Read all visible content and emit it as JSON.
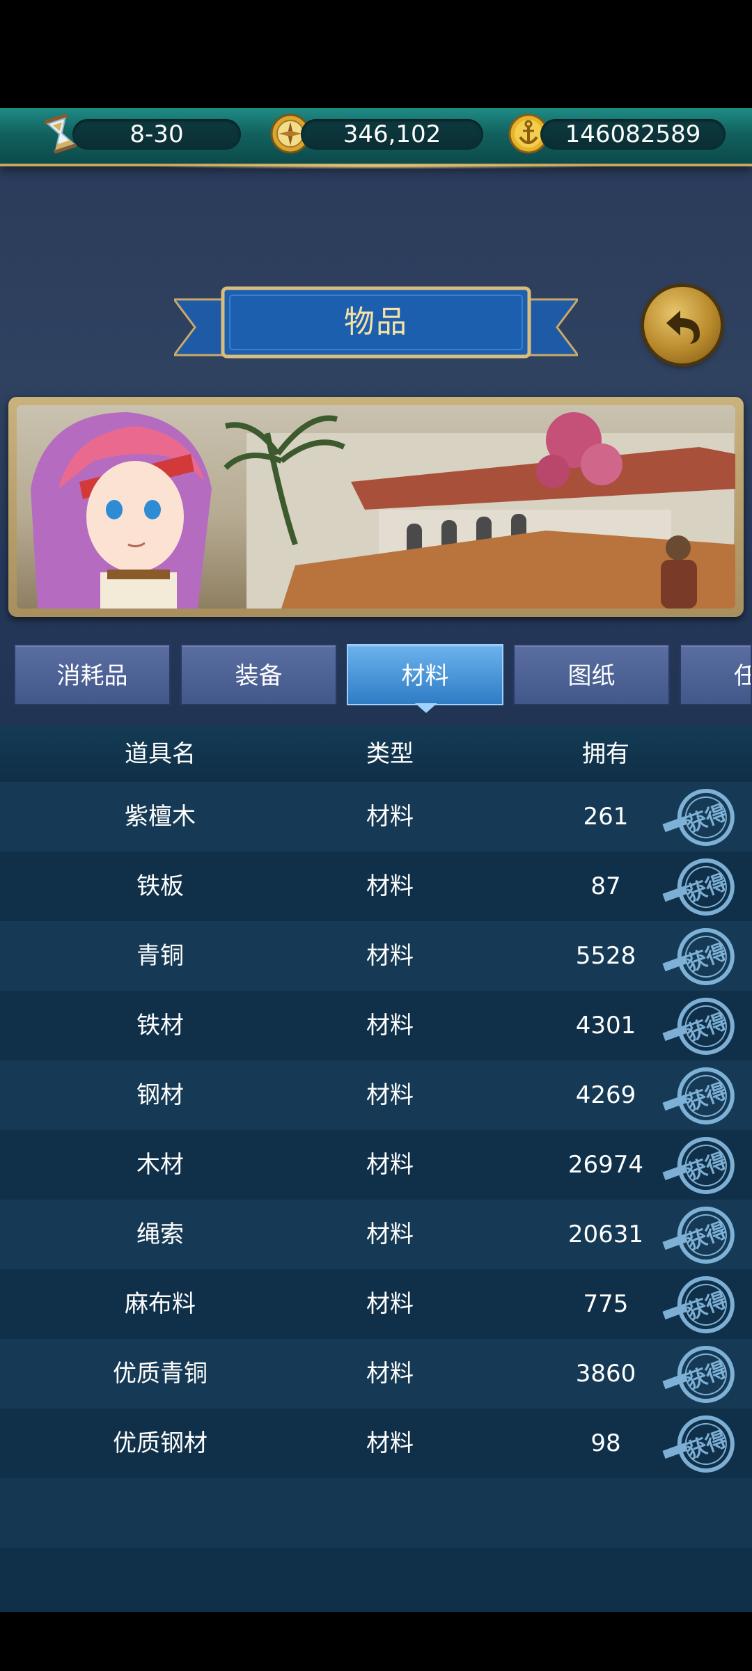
{
  "resources": {
    "time": "8-30",
    "compass_value": "346,102",
    "gold_value": "146082589"
  },
  "title": "物品",
  "tabs": [
    "消耗品",
    "装备",
    "材料",
    "图纸",
    "任"
  ],
  "active_tab": 2,
  "table": {
    "headers": [
      "道具名",
      "类型",
      "拥有"
    ],
    "rows": [
      {
        "name": "紫檀木",
        "type": "材料",
        "count": "261"
      },
      {
        "name": "铁板",
        "type": "材料",
        "count": "87"
      },
      {
        "name": "青铜",
        "type": "材料",
        "count": "5528"
      },
      {
        "name": "铁材",
        "type": "材料",
        "count": "4301"
      },
      {
        "name": "钢材",
        "type": "材料",
        "count": "4269"
      },
      {
        "name": "木材",
        "type": "材料",
        "count": "26974"
      },
      {
        "name": "绳索",
        "type": "材料",
        "count": "20631"
      },
      {
        "name": "麻布料",
        "type": "材料",
        "count": "775"
      },
      {
        "name": "优质青铜",
        "type": "材料",
        "count": "3860"
      },
      {
        "name": "优质钢材",
        "type": "材料",
        "count": "98"
      }
    ],
    "obtain_stamp_label": "获得"
  },
  "icons": {
    "time": "hourglass-icon",
    "compass": "compass-icon",
    "gold": "anchor-coin-icon",
    "back": "back-arrow-icon"
  },
  "colors": {
    "resource_bar": "#12625f",
    "tab_inactive": "#42578a",
    "tab_active": "#2f7cc6",
    "title_text": "#f6e2a6",
    "stamp": "#8fc6ec"
  }
}
